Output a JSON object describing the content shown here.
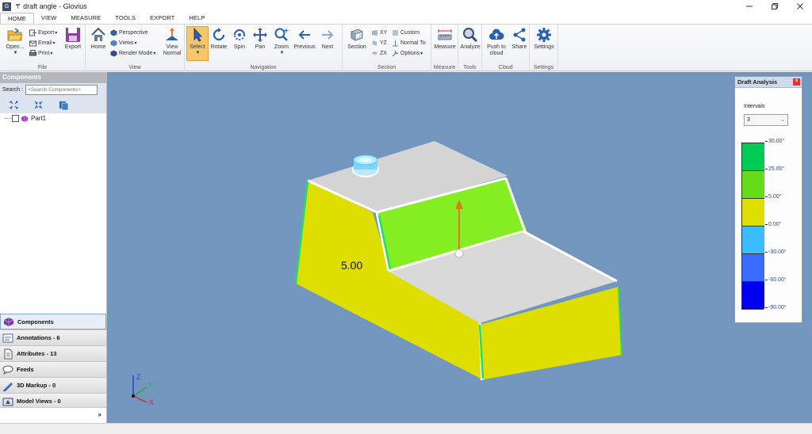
{
  "window": {
    "title": "draft angle - Glovius",
    "controls": [
      "minimize",
      "restore",
      "close"
    ]
  },
  "menu": {
    "tabs": [
      "HOME",
      "VIEW",
      "MEASURE",
      "TOOLS",
      "EXPORT",
      "HELP"
    ],
    "active": "HOME"
  },
  "ribbon": {
    "file": {
      "group_label": "File",
      "open_label": "Open...",
      "export_small": "Export",
      "email_small": "Email",
      "print_small": "Print",
      "export_label": "Export"
    },
    "view": {
      "group_label": "View",
      "home_label": "Home",
      "perspective": "Perspective",
      "views": "Views",
      "render_mode": "Render Mode",
      "view_normal": "View Normal"
    },
    "navigation": {
      "group_label": "Navigation",
      "select": "Select",
      "rotate": "Rotate",
      "spin": "Spin",
      "pan": "Pan",
      "zoom": "Zoom",
      "previous": "Previous",
      "next": "Next"
    },
    "section": {
      "group_label": "Section",
      "section": "Section",
      "xy": "XY",
      "yz": "YZ",
      "zx": "ZX",
      "custom": "Custom",
      "normal_to": "Normal To",
      "options": "Options"
    },
    "measure": {
      "group_label": "Measure",
      "measure": "Measure"
    },
    "tools": {
      "group_label": "Tools",
      "analyze": "Analyze"
    },
    "cloud": {
      "group_label": "Cloud",
      "push_to_cloud": "Push to cloud",
      "share": "Share"
    },
    "settings": {
      "group_label": "Settings",
      "settings": "Settings"
    }
  },
  "left_panel": {
    "header": "Components",
    "search_label": "Search :",
    "search_placeholder": "<Search Components>",
    "tree": [
      {
        "label": "Part1"
      }
    ],
    "accordion": [
      {
        "label": "Components",
        "selected": true
      },
      {
        "label": "Annotations - 6"
      },
      {
        "label": "Attributes - 13"
      },
      {
        "label": "Feeds"
      },
      {
        "label": "3D Markup - 0"
      },
      {
        "label": "Model Views - 0"
      }
    ],
    "more": "»"
  },
  "viewport": {
    "background": "#7396bf",
    "annotation_value": "5.00",
    "axes": {
      "z": "Z",
      "y": "Y",
      "x": "X"
    }
  },
  "draft_analysis": {
    "title": "Draft Analysis",
    "intervals_label": "Intervals",
    "intervals_value": "3",
    "legend_colors": [
      "#00cc55",
      "#66dd1a",
      "#dede00",
      "#3bbcff",
      "#3a6cff",
      "#0000f0"
    ],
    "legend_ticks": [
      "30.00°",
      "25.00°",
      "5.00°",
      "0.00°",
      "-30.00°",
      "-60.00°",
      "-90.00°"
    ]
  }
}
